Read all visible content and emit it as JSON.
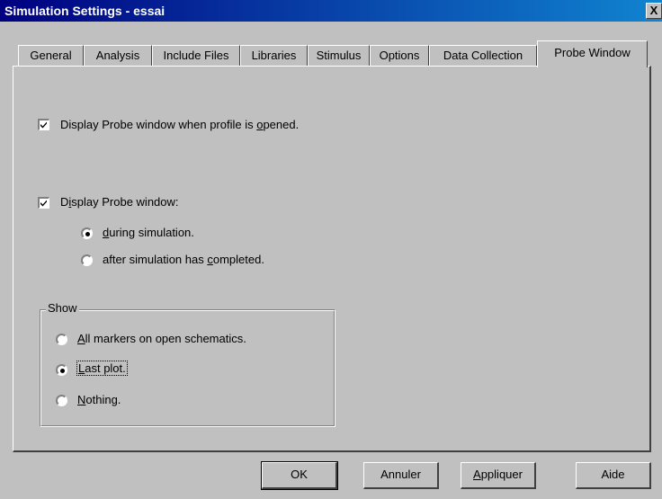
{
  "window": {
    "title": "Simulation Settings - essai",
    "close_label": "X"
  },
  "tabs": [
    {
      "label": "General",
      "active": false
    },
    {
      "label": "Analysis",
      "active": false
    },
    {
      "label": "Include Files",
      "active": false
    },
    {
      "label": "Libraries",
      "active": false
    },
    {
      "label": "Stimulus",
      "active": false
    },
    {
      "label": "Options",
      "active": false
    },
    {
      "label": "Data Collection",
      "active": false
    },
    {
      "label": "Probe Window",
      "active": true
    }
  ],
  "probe": {
    "open_on_profile": {
      "pre": "Display Probe window when profile is ",
      "mn": "o",
      "post": "pened.",
      "checked": true
    },
    "display_probe": {
      "pre": "D",
      "mn": "i",
      "post": "splay Probe window:",
      "checked": true
    },
    "during": {
      "pre": "",
      "mn": "d",
      "post": "uring simulation.",
      "selected": true
    },
    "after": {
      "pre": "after simulation has ",
      "mn": "c",
      "post": "ompleted.",
      "selected": false
    }
  },
  "show_group": {
    "title": "Show",
    "all_markers": {
      "pre": "",
      "mn": "A",
      "post": "ll markers on open schematics.",
      "selected": false
    },
    "last_plot": {
      "pre": "",
      "mn": "L",
      "post": "ast plot.",
      "selected": true
    },
    "nothing": {
      "pre": "",
      "mn": "N",
      "post": "othing.",
      "selected": false
    }
  },
  "buttons": {
    "ok": "OK",
    "cancel": "Annuler",
    "apply_pre": "",
    "apply_mn": "A",
    "apply_post": "ppliquer",
    "help": "Aide"
  }
}
